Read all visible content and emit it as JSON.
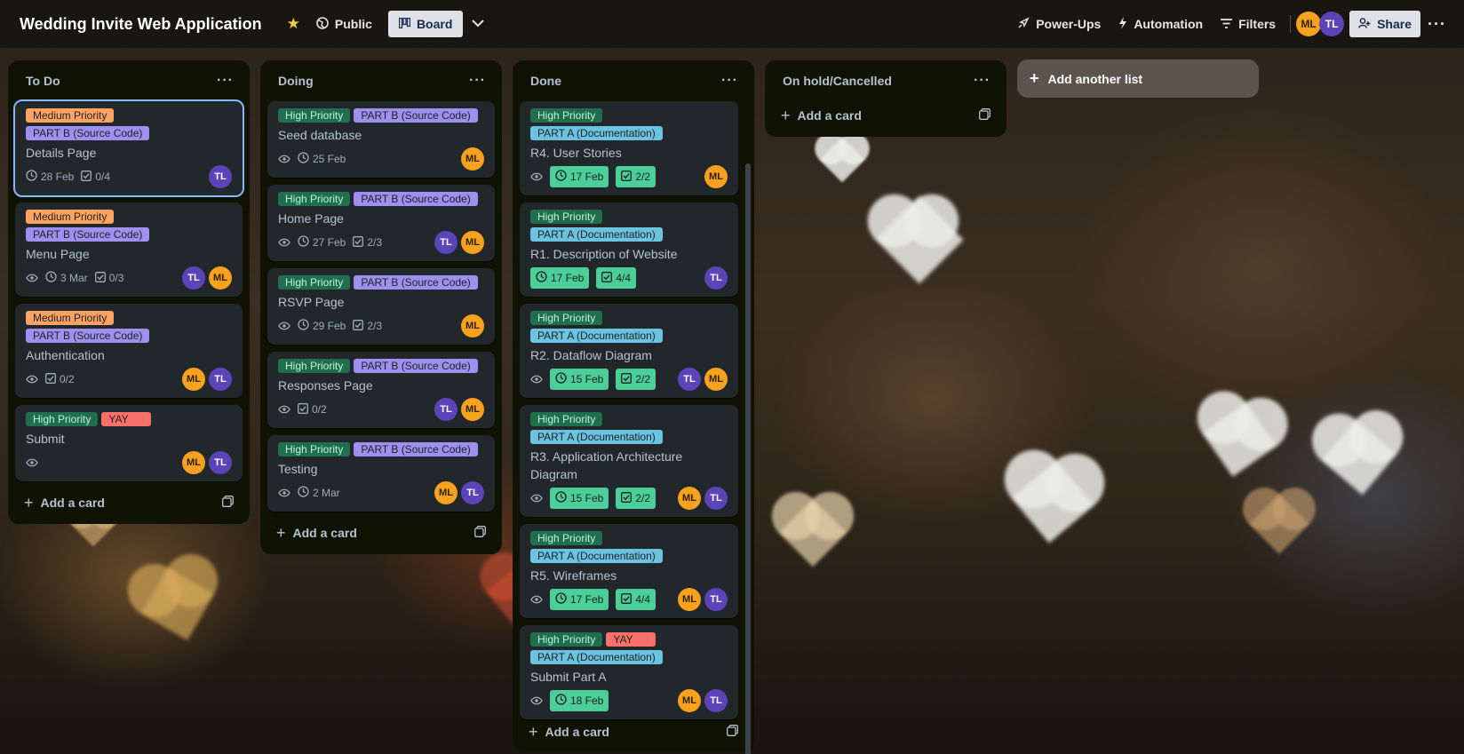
{
  "header": {
    "title": "Wedding Invite Web Application",
    "visibility": "Public",
    "view": "Board",
    "powerups": "Power-Ups",
    "automation": "Automation",
    "filters": "Filters",
    "share": "Share",
    "members": [
      "ML",
      "TL"
    ]
  },
  "lists": [
    {
      "title": "To Do",
      "add_card": "Add a card",
      "cards": [
        {
          "labels": [
            {
              "text": "Medium Priority",
              "kind": "medium"
            },
            {
              "text": "PART B (Source Code)",
              "kind": "partb"
            }
          ],
          "title": "Details Page",
          "due": "28 Feb",
          "checklist": "0/4",
          "watch": false,
          "members": [
            "TL"
          ]
        },
        {
          "labels": [
            {
              "text": "Medium Priority",
              "kind": "medium"
            },
            {
              "text": "PART B (Source Code)",
              "kind": "partb"
            }
          ],
          "title": "Menu Page",
          "watch": true,
          "due": "3 Mar",
          "checklist": "0/3",
          "members": [
            "TL",
            "ML"
          ]
        },
        {
          "labels": [
            {
              "text": "Medium Priority",
              "kind": "medium"
            },
            {
              "text": "PART B (Source Code)",
              "kind": "partb"
            }
          ],
          "title": "Authentication",
          "watch": true,
          "checklist": "0/2",
          "members": [
            "ML",
            "TL"
          ]
        },
        {
          "labels": [
            {
              "text": "High Priority",
              "kind": "high"
            },
            {
              "text": "YAY",
              "kind": "yay"
            }
          ],
          "title": "Submit",
          "watch": true,
          "members": [
            "ML",
            "TL"
          ]
        }
      ]
    },
    {
      "title": "Doing",
      "add_card": "Add a card",
      "cards": [
        {
          "labels": [
            {
              "text": "High Priority",
              "kind": "high"
            },
            {
              "text": "PART B (Source Code)",
              "kind": "partb"
            }
          ],
          "title": "Seed database",
          "watch": true,
          "due": "25 Feb",
          "members": [
            "ML"
          ]
        },
        {
          "labels": [
            {
              "text": "High Priority",
              "kind": "high"
            },
            {
              "text": "PART B (Source Code)",
              "kind": "partb"
            }
          ],
          "title": "Home Page",
          "watch": true,
          "due": "27 Feb",
          "checklist": "2/3",
          "members": [
            "TL",
            "ML"
          ]
        },
        {
          "labels": [
            {
              "text": "High Priority",
              "kind": "high"
            },
            {
              "text": "PART B (Source Code)",
              "kind": "partb"
            }
          ],
          "title": "RSVP Page",
          "watch": true,
          "due": "29 Feb",
          "checklist": "2/3",
          "members": [
            "ML"
          ]
        },
        {
          "labels": [
            {
              "text": "High Priority",
              "kind": "high"
            },
            {
              "text": "PART B (Source Code)",
              "kind": "partb"
            }
          ],
          "title": "Responses Page",
          "watch": true,
          "checklist": "0/2",
          "members": [
            "TL",
            "ML"
          ]
        },
        {
          "labels": [
            {
              "text": "High Priority",
              "kind": "high"
            },
            {
              "text": "PART B (Source Code)",
              "kind": "partb"
            }
          ],
          "title": "Testing",
          "watch": true,
          "due": "2 Mar",
          "members": [
            "ML",
            "TL"
          ]
        }
      ]
    },
    {
      "title": "Done",
      "add_card": "Add a card",
      "cards": [
        {
          "labels": [
            {
              "text": "High Priority",
              "kind": "high"
            },
            {
              "text": "PART A (Documentation)",
              "kind": "parta"
            }
          ],
          "title": "R4. User Stories",
          "watch": true,
          "due": "17 Feb",
          "due_done": true,
          "checklist": "2/2",
          "checklist_done": true,
          "members": [
            "ML"
          ]
        },
        {
          "labels": [
            {
              "text": "High Priority",
              "kind": "high"
            },
            {
              "text": "PART A (Documentation)",
              "kind": "parta"
            }
          ],
          "title": "R1. Description of Website",
          "watch": false,
          "due": "17 Feb",
          "due_done": true,
          "checklist": "4/4",
          "checklist_done": true,
          "members": [
            "TL"
          ]
        },
        {
          "labels": [
            {
              "text": "High Priority",
              "kind": "high"
            },
            {
              "text": "PART A (Documentation)",
              "kind": "parta"
            }
          ],
          "title": "R2. Dataflow Diagram",
          "watch": true,
          "due": "15 Feb",
          "due_done": true,
          "checklist": "2/2",
          "checklist_done": true,
          "members": [
            "TL",
            "ML"
          ]
        },
        {
          "labels": [
            {
              "text": "High Priority",
              "kind": "high"
            },
            {
              "text": "PART A (Documentation)",
              "kind": "parta"
            }
          ],
          "title": "R3. Application Architecture Diagram",
          "watch": true,
          "due": "15 Feb",
          "due_done": true,
          "checklist": "2/2",
          "checklist_done": true,
          "members": [
            "ML",
            "TL"
          ]
        },
        {
          "labels": [
            {
              "text": "High Priority",
              "kind": "high"
            },
            {
              "text": "PART A (Documentation)",
              "kind": "parta"
            }
          ],
          "title": "R5. Wireframes",
          "watch": true,
          "due": "17 Feb",
          "due_done": true,
          "checklist": "4/4",
          "checklist_done": true,
          "members": [
            "ML",
            "TL"
          ]
        },
        {
          "labels": [
            {
              "text": "High Priority",
              "kind": "high"
            },
            {
              "text": "YAY",
              "kind": "yay"
            },
            {
              "text": "PART A (Documentation)",
              "kind": "parta"
            }
          ],
          "title": "Submit Part A",
          "watch": true,
          "due": "18 Feb",
          "due_done": true,
          "members": [
            "ML",
            "TL"
          ]
        }
      ]
    },
    {
      "title": "On hold/Cancelled",
      "add_card": "Add a card",
      "cards": []
    }
  ],
  "add_list": "Add another list"
}
